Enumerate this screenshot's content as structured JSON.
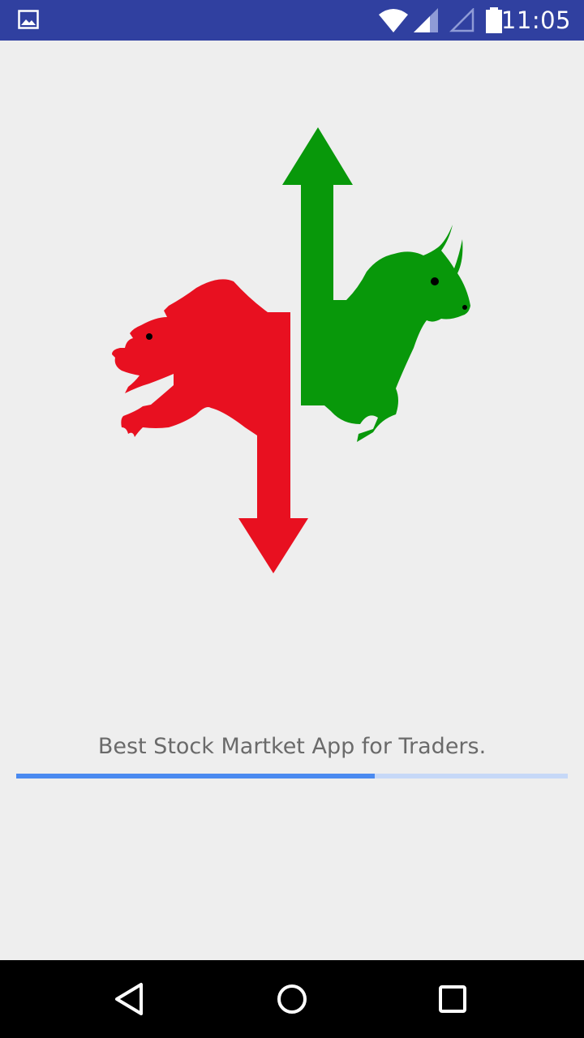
{
  "status_bar": {
    "time": "11:05",
    "icons": [
      "gallery-icon",
      "wifi-icon",
      "signal-icon",
      "signal-icon",
      "battery-icon"
    ],
    "background": "#3040a0"
  },
  "splash": {
    "logo": [
      "bear-icon",
      "bull-icon"
    ],
    "tagline": "Best Stock Martket App for Traders.",
    "progress": 0.65,
    "colors": {
      "bear": "#e81020",
      "bull": "#08980a",
      "progress": "#4a8af0",
      "track": "#c6d8f7"
    }
  },
  "nav_bar": {
    "icons": [
      "back-icon",
      "home-icon",
      "recents-icon"
    ]
  }
}
